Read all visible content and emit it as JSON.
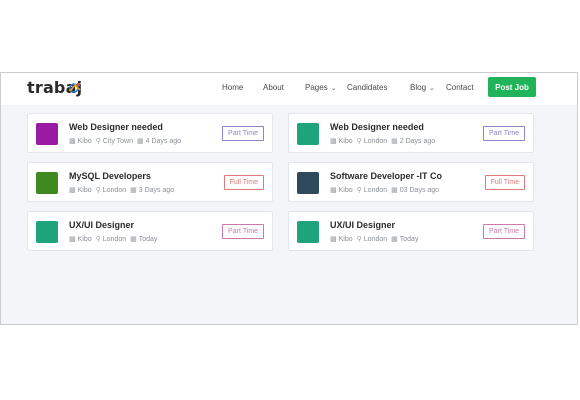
{
  "brand": {
    "name": "trabaj"
  },
  "nav": {
    "items": [
      {
        "label": "Home",
        "dropdown": false
      },
      {
        "label": "About",
        "dropdown": false
      },
      {
        "label": "Pages",
        "dropdown": true
      },
      {
        "label": "Candidates",
        "dropdown": false
      },
      {
        "label": "Blog",
        "dropdown": true
      },
      {
        "label": "Contact",
        "dropdown": false
      }
    ],
    "cta": "Post Job",
    "cta_color": "#21b35a"
  },
  "jobs": [
    {
      "title": "Web Designer needed",
      "company": "Kibo",
      "location": "City Town",
      "posted": "4 Days ago",
      "type": "Part Time",
      "logo_color": "#9b1aa3",
      "type_color": "#8c86c8"
    },
    {
      "title": "Web Designer needed",
      "company": "Kibo",
      "location": "London",
      "posted": "2 Days ago",
      "type": "Part Time",
      "logo_color": "#1ea37a",
      "type_color": "#8c86c8"
    },
    {
      "title": "MySQL Developers",
      "company": "Kibo",
      "location": "London",
      "posted": "3 Days ago",
      "type": "Full Time",
      "logo_color": "#3e8a1e",
      "type_color": "#e07a7a"
    },
    {
      "title": "Software Developer -IT Co",
      "company": "Kibo",
      "location": "London",
      "posted": "03 Days ago",
      "type": "Full Time",
      "logo_color": "#2f4a5a",
      "type_color": "#e07a7a"
    },
    {
      "title": "UX/UI Designer",
      "company": "Kibo",
      "location": "London",
      "posted": "Today",
      "type": "Part Time",
      "logo_color": "#1ea37a",
      "type_color": "#c97aa9"
    },
    {
      "title": "UX/UI Designer",
      "company": "Kibo",
      "location": "London",
      "posted": "Today",
      "type": "Part Time",
      "logo_color": "#1ea37a",
      "type_color": "#c97aa9"
    }
  ]
}
